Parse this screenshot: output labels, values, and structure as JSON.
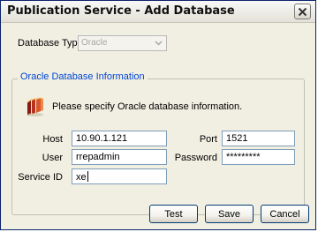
{
  "window": {
    "title": "Publication Service - Add Database"
  },
  "icons": {
    "close": "close-icon",
    "info": "database-stack-icon",
    "dropdown": "chevron-down-icon"
  },
  "database_type": {
    "label": "Database Type",
    "value": "Oracle"
  },
  "group": {
    "legend": "Oracle Database Information",
    "message": "Please specify Oracle database information."
  },
  "fields": {
    "host": {
      "label": "Host",
      "value": "10.90.1.121"
    },
    "port": {
      "label": "Port",
      "value": "1521"
    },
    "user": {
      "label": "User",
      "value": "rrepadmin"
    },
    "password": {
      "label": "Password",
      "value": "*********"
    },
    "service_id": {
      "label": "Service ID",
      "value": "xe"
    }
  },
  "buttons": {
    "test": "Test",
    "save": "Save",
    "cancel": "Cancel"
  },
  "colors": {
    "accent": "#0046d5",
    "window_bg": "#f1efe2",
    "input_border": "#7f9db9"
  }
}
